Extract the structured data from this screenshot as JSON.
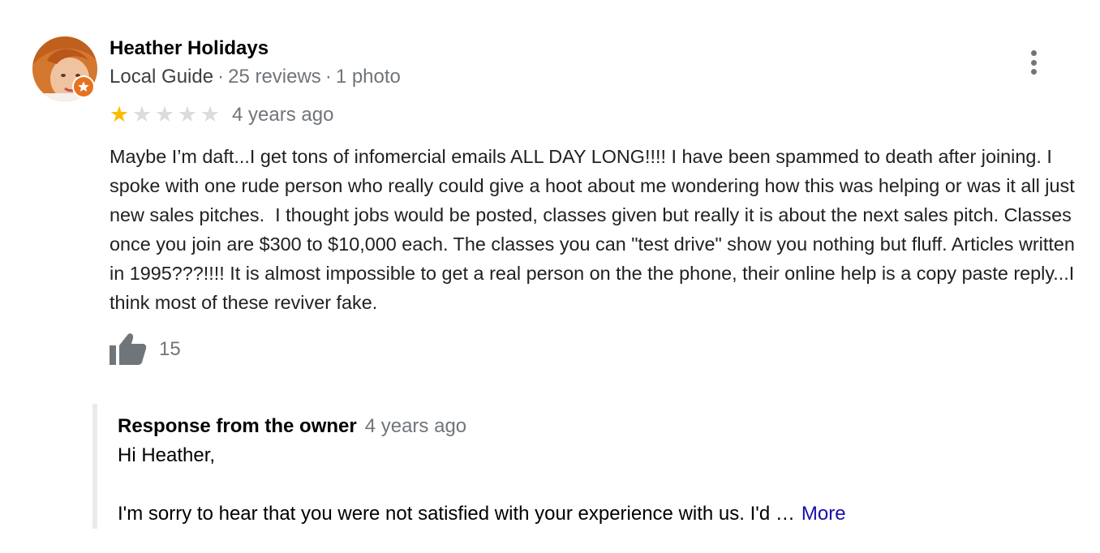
{
  "reviewer": {
    "name": "Heather Holidays",
    "badge": "Local Guide",
    "reviews": "25 reviews",
    "photos": "1 photo",
    "separator": "·"
  },
  "rating": {
    "stars": 1,
    "max": 5,
    "filled_color": "#fbbc04",
    "empty_color": "#dadce0",
    "date": "4 years ago"
  },
  "review_text": "Maybe I’m daft...I get tons of infomercial emails ALL DAY LONG!!!! I have been spammed to death after joining. I spoke with one rude person who really could give a hoot about me wondering how this was helping or was it all just new sales pitches.  I thought jobs would be posted, classes given but really it is about the next sales pitch. Classes once you join are $300 to $10,000 each. The classes you can \"test drive\" show you nothing but fluff. Articles written in 1995???!!!! It is almost impossible to get a real person on the the phone, their online help is a copy paste reply...I think most of these reviver fake.",
  "likes": {
    "count": "15",
    "icon": "thumbs-up-icon"
  },
  "owner_response": {
    "title": "Response from the owner",
    "date": "4 years ago",
    "greeting": "Hi Heather,",
    "body": "I'm sorry to hear that you were not satisfied with your experience with us. I'd …",
    "more_label": "More"
  },
  "colors": {
    "guide_badge": "#e8711e",
    "link": "#1a0dab",
    "muted": "#70757a"
  }
}
